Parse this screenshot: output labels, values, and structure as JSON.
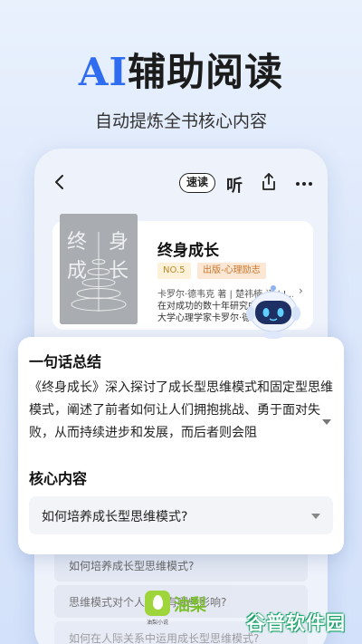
{
  "hero": {
    "title_ai": "AI",
    "title_rest": "辅助阅读",
    "subtitle": "自动提炼全书核心内容"
  },
  "toolbar": {
    "speed_label": "速读",
    "listen_label": "听"
  },
  "book": {
    "title": "终身成长",
    "rank": "NO.5",
    "category": "出版-心理励志",
    "author": "卡罗尔·德韦克 著 | 楚祎楠 译 | J...",
    "blurb": "在对成功的数十年研究中，斯坦福大学心理学家卡罗尔·德韦克",
    "cover_text": "终身成长"
  },
  "summary": {
    "section_title": "一句话总结",
    "body": "《终身成长》深入探讨了成长型思维模式和固定型思维模式，阐述了前者如何让人们拥抱挑战、勇于面对失败，从而持续进步和发展，而后者则会阻",
    "core_title": "核心内容",
    "question": "如何培养成长型思维模式?"
  },
  "background_list": [
    {
      "text": "如何培养成长型思维模式?"
    },
    {
      "text": "思维模式对个人发展有哪些影响?"
    },
    {
      "text": "如何在人际关系中运用成长型思维模式?"
    }
  ],
  "brand": {
    "name": "油梨",
    "small": "油梨小说"
  },
  "watermark": "谷普软件园",
  "colors": {
    "accent": "#2f6cf0",
    "brand_green": "#7bbf29",
    "badge_gold": "#b98a2a",
    "badge_orange": "#c9772f"
  }
}
